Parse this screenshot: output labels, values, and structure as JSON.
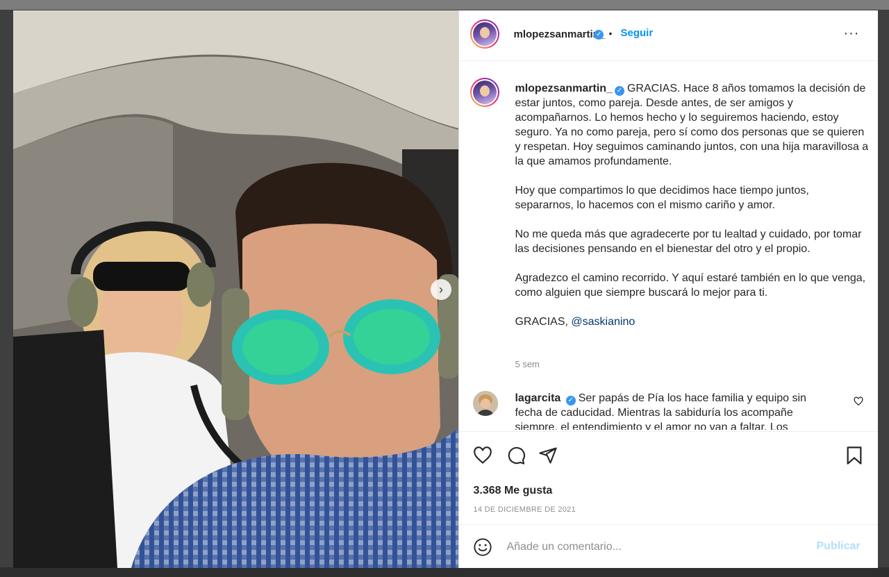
{
  "post": {
    "username": "mlopezsanmartin_",
    "follow_label": "Seguir",
    "separator": "•",
    "more_label": "···",
    "caption_paragraphs": [
      "GRACIAS. Hace 8 años tomamos la decisión de estar juntos, como pareja. Desde antes, de ser amigos y acompañarnos. Lo hemos hecho y lo seguiremos haciendo, estoy seguro. Ya no como pareja, pero sí como dos personas que se quieren y respetan. Hoy seguimos caminando juntos, con una hija maravillosa a la que amamos profundamente.",
      "Hoy que compartimos lo que decidimos hace tiempo juntos, separarnos, lo hacemos con el mismo cariño y amor.",
      "No me queda más que agradecerte por tu lealtad y cuidado, por tomar las decisiones pensando en el bienestar del otro y el propio.",
      "Agradezco el camino recorrido. Y aquí estaré también en lo que venga, como alguien que siempre buscará lo mejor para ti."
    ],
    "closing": "GRACIAS,",
    "mention": "@saskianino",
    "time_ago": "5 sem",
    "likes": "3.368 Me gusta",
    "date": "14 DE DICIEMBRE DE 2021"
  },
  "comment": {
    "username": "lagarcita",
    "text": "Ser papás de Pía los hace familia y equipo sin fecha de caducidad. Mientras la sabiduría los acompañe siempre, el entendimiento y el amor no van a faltar. Los"
  },
  "add_comment": {
    "placeholder": "Añade un comentario...",
    "publish_label": "Publicar"
  },
  "media": {
    "next_label": "›"
  },
  "icons": {
    "verified": "verified-badge-icon",
    "like": "heart-icon",
    "comment": "comment-bubble-icon",
    "share": "paper-plane-icon",
    "save": "bookmark-icon",
    "emoji": "smiley-icon",
    "next": "chevron-right-icon"
  },
  "colors": {
    "accent": "#0095f6",
    "publish_disabled": "#b2dffc",
    "verified": "#3897f0",
    "muted": "#8e8e8e"
  }
}
